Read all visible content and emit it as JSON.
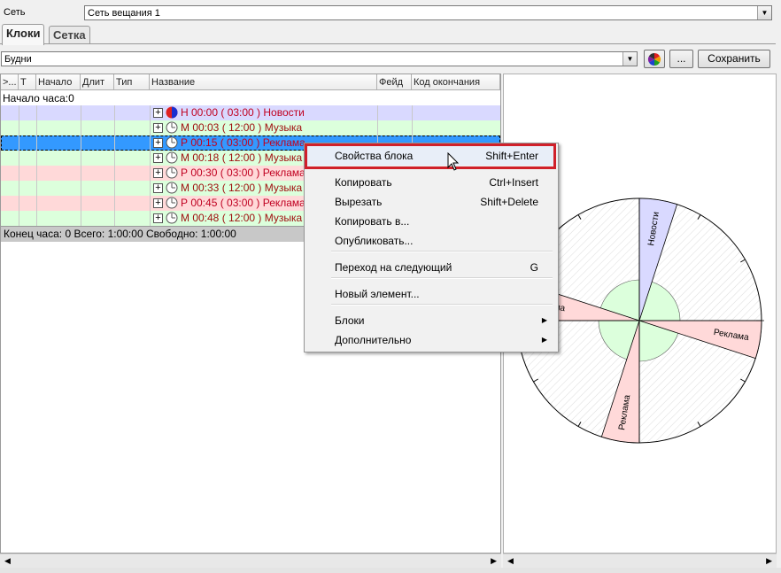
{
  "header": {
    "network_label": "Сеть",
    "network_value": "Сеть вещания 1"
  },
  "tabs": [
    {
      "label": "Клоки"
    },
    {
      "label": "Сетка"
    }
  ],
  "clock_bar": {
    "selected": "Будни",
    "more_button": "...",
    "save_button": "Сохранить"
  },
  "grid": {
    "columns": [
      ">...",
      "Т",
      "Начало",
      "Длит",
      "Тип",
      "Название",
      "Фейд",
      "Код окончания"
    ],
    "hour_start": "Начало часа:0",
    "rows": [
      {
        "text": "Н 00:00 ( 03:00 ) Новости",
        "bg": "#d9d9ff",
        "color": "#c00020",
        "icon": "news"
      },
      {
        "text": "М 00:03 ( 12:00 ) Музыка",
        "bg": "#dcffdc",
        "color": "#a01010",
        "icon": "clock"
      },
      {
        "text": "Р 00:15 ( 03:00 ) Реклама",
        "bg": "#3399ff",
        "color": "#c00020",
        "icon": "clock",
        "selected": true
      },
      {
        "text": "М 00:18 ( 12:00 ) Музыка",
        "bg": "#dcffdc",
        "color": "#a01010",
        "icon": "clock"
      },
      {
        "text": "Р 00:30 ( 03:00 ) Реклама",
        "bg": "#ffd9d9",
        "color": "#c00020",
        "icon": "clock"
      },
      {
        "text": "М 00:33 ( 12:00 ) Музыка",
        "bg": "#dcffdc",
        "color": "#a01010",
        "icon": "clock"
      },
      {
        "text": "Р 00:45 ( 03:00 ) Реклама",
        "bg": "#ffd9d9",
        "color": "#c00020",
        "icon": "clock"
      },
      {
        "text": "М 00:48 ( 12:00 ) Музыка",
        "bg": "#dcffdc",
        "color": "#a01010",
        "icon": "clock"
      }
    ],
    "footer": "Конец часа: 0 Всего: 1:00:00 Свободно:  1:00:00"
  },
  "context_menu": {
    "items": [
      {
        "label": "Свойства блока",
        "shortcut": "Shift+Enter",
        "highlighted": true
      },
      {
        "label": "Копировать",
        "shortcut": "Ctrl+Insert"
      },
      {
        "label": "Вырезать",
        "shortcut": "Shift+Delete"
      },
      {
        "label": "Копировать в...",
        "shortcut": ""
      },
      {
        "label": "Опубликовать...",
        "shortcut": ""
      },
      {
        "label": "Переход на следующий",
        "shortcut": "G"
      },
      {
        "label": "Новый элемент...",
        "shortcut": ""
      },
      {
        "label": "Блоки",
        "shortcut": "",
        "submenu": true
      },
      {
        "label": "Дополнительно",
        "shortcut": "",
        "submenu": true
      }
    ]
  },
  "clock_diagram": {
    "segment_labels": [
      "Новости",
      "Реклама",
      "Реклама",
      "Реклама"
    ],
    "colors": {
      "news": "#d9d9ff",
      "ads": "#ffd9d9",
      "music": "#dcffdc"
    }
  },
  "colors": {
    "highlight_box": "#d0202a",
    "selection": "#3399ff"
  }
}
